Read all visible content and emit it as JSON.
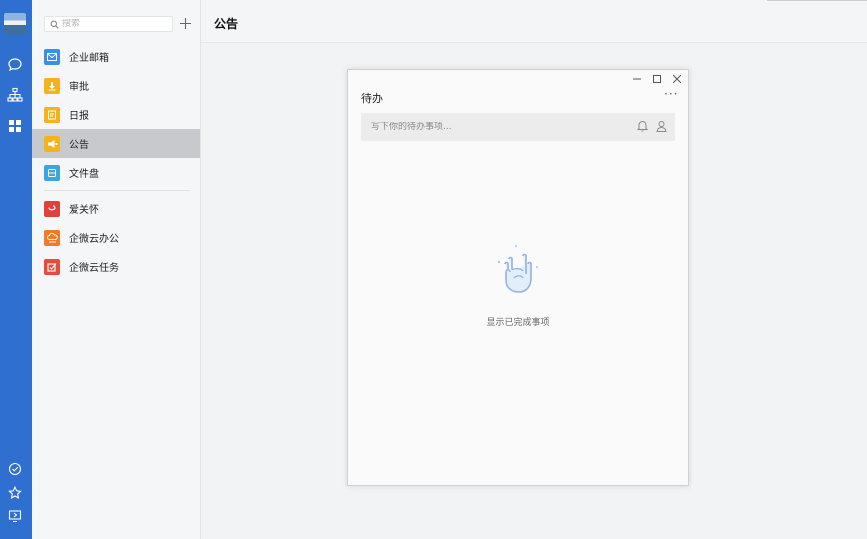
{
  "rail": {
    "icons": [
      "avatar",
      "chat-icon",
      "org-chart-icon",
      "apps-grid-icon",
      "check-circle-icon",
      "star-icon",
      "screen-icon"
    ]
  },
  "sidebar": {
    "search_placeholder": "搜索",
    "add_icon": "plus-icon",
    "items": [
      {
        "label": "企业邮箱",
        "icon": "mail-icon",
        "color": "#3d8fe6"
      },
      {
        "label": "审批",
        "icon": "approval-icon",
        "color": "#f4b21c"
      },
      {
        "label": "日报",
        "icon": "report-icon",
        "color": "#f4b21c"
      },
      {
        "label": "公告",
        "icon": "announcement-icon",
        "color": "#f4b21c",
        "active": true
      },
      {
        "label": "文件盘",
        "icon": "file-drive-icon",
        "color": "#3aa5e0"
      },
      {
        "label": "爱关怀",
        "icon": "care-icon",
        "color": "#e0413a"
      },
      {
        "label": "企微云办公",
        "icon": "cloud-office-icon",
        "color": "#f07a2a"
      },
      {
        "label": "企微云任务",
        "icon": "cloud-task-icon",
        "color": "#e84a3f"
      }
    ]
  },
  "header": {
    "title": "公告"
  },
  "todo_window": {
    "title": "待办",
    "more_label": "···",
    "input_placeholder": "写下你的待办事项...",
    "empty_text": "显示已完成事项"
  },
  "colors": {
    "rail": "#2f6fd0",
    "active_item": "#c8c9cc",
    "empty_illustration": "#a9c9ec"
  }
}
